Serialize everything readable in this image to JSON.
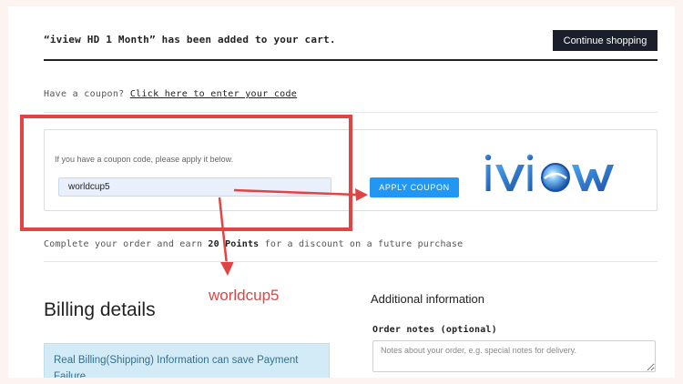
{
  "notice": {
    "product": "“iview HD 1 Month”",
    "message": " has been added to your cart.",
    "continue_label": "Continue shopping"
  },
  "coupon": {
    "prompt": "Have a coupon? ",
    "link_label": "Click here to enter your code",
    "hint": "If you have a coupon code, please apply it below.",
    "input_value": "worldcup5",
    "apply_label": "APPLY COUPON"
  },
  "logo": {
    "text": "iview",
    "color": "#1e5fb4"
  },
  "earn": {
    "prefix": "Complete your order and earn ",
    "points": "20 Points",
    "suffix": " for a discount on a future purchase"
  },
  "annotation": {
    "text": "worldcup5",
    "color": "#e24444"
  },
  "billing": {
    "title": "Billing details",
    "info_text": "Real Billing(Shipping) Information can save Payment Failure"
  },
  "additional": {
    "title": "Additional information",
    "notes_label": "Order notes (optional)",
    "notes_placeholder": "Notes about your order, e.g. special notes for delivery."
  }
}
